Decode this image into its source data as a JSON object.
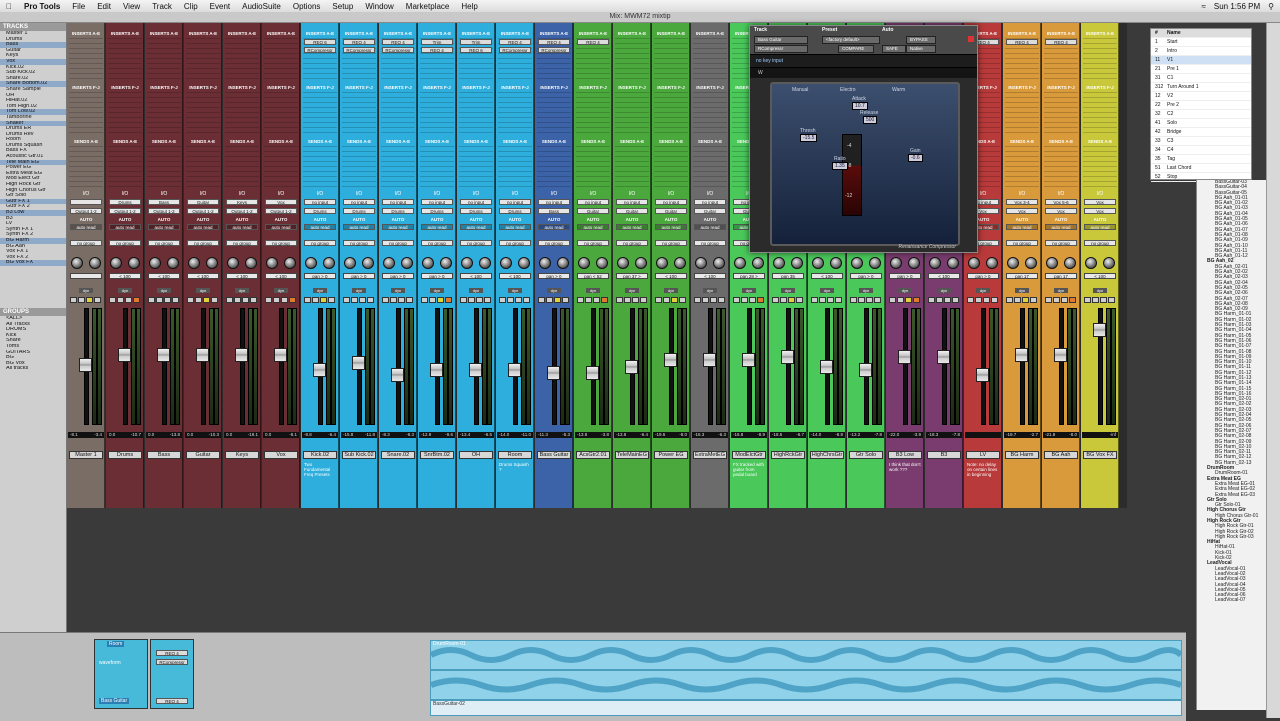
{
  "menubar": {
    "app": "Pro Tools",
    "items": [
      "File",
      "Edit",
      "View",
      "Track",
      "Clip",
      "Event",
      "AudioSuite",
      "Options",
      "Setup",
      "Window",
      "Marketplace",
      "Help"
    ],
    "clock": "Sun 1:56 PM"
  },
  "window_title": "Mix: MWM72 mixtip",
  "tracks_panel": {
    "title": "TRACKS",
    "items": [
      "Master 1",
      "Drums",
      "Bass",
      "Guitar",
      "Keys",
      "Vox",
      "Kick.02",
      "Sub Kick.02",
      "Snare.02",
      "Snare Bottom.02",
      "Snare Sample",
      "OH",
      "HiHat.02",
      "Tom High.02",
      "Tom Low.02",
      "Tamborine",
      "Shaker",
      "Drums ER",
      "Drums Rev",
      "Room",
      "Drums Squash",
      "Bass FX",
      "Acoustic Gtr.01",
      "Tele Main EG",
      "Power EG",
      "Extra Meat EG",
      "Mod Elect Gtr",
      "High Rock Gtr",
      "High Chorus Gtr",
      "Gtr Solo",
      "Gutr FX 1",
      "Gutr FX 2",
      "B3 Low",
      "B3",
      "LV",
      "Synth FX 1",
      "Synth FX 2",
      "BG Harm",
      "BG Aah",
      "Vox FX 1",
      "Vox FX 2",
      "BG Vox FX"
    ]
  },
  "groups_panel": {
    "title": "GROUPS",
    "items": [
      "<ALL>",
      "All Tracks",
      "DRUMS",
      "Kick",
      "Snare",
      "Toms",
      "GUITARS",
      "BG",
      "BG Vox",
      "All tracks"
    ]
  },
  "strip_headers": {
    "inserts_ae": "INSERTS A-E",
    "inserts_fj": "INSERTS F-J",
    "sends": "SENDS A-E",
    "io": "I/O",
    "auto": "AUTO",
    "group": "no group",
    "dyn": "dyn"
  },
  "strips": [
    {
      "name": "Master 1",
      "color": "#7a6d66",
      "input": "",
      "output": "Output 1-2",
      "auto": "auto read",
      "pan": "",
      "ins1": "",
      "ins2": "",
      "volL": "-8.1",
      "volR": "-3.4",
      "comment": ""
    },
    {
      "name": "Drums",
      "color": "#6b2e34",
      "input": "Drums",
      "output": "Output 1-2",
      "auto": "auto read",
      "pan": "< 100",
      "ins1": "",
      "ins2": "",
      "volL": "0.0",
      "volR": "-10.7",
      "comment": ""
    },
    {
      "name": "Bass",
      "color": "#6b2e34",
      "input": "Bass",
      "output": "Output 1-2",
      "auto": "auto read",
      "pan": "< 100",
      "ins1": "",
      "ins2": "",
      "volL": "0.0",
      "volR": "-13.8",
      "comment": ""
    },
    {
      "name": "Guitar",
      "color": "#6b2e34",
      "input": "Guitar",
      "output": "Output 1-2",
      "auto": "auto read",
      "pan": "< 100",
      "ins1": "",
      "ins2": "",
      "volL": "0.0",
      "volR": "-10.3",
      "comment": ""
    },
    {
      "name": "Keys",
      "color": "#6b2e34",
      "input": "Keys",
      "output": "Output 1-2",
      "auto": "auto read",
      "pan": "< 100",
      "ins1": "",
      "ins2": "",
      "volL": "0.0",
      "volR": "-19.1",
      "comment": ""
    },
    {
      "name": "Vox",
      "color": "#6b2e34",
      "input": "Vox",
      "output": "Output 1-2",
      "auto": "auto read",
      "pan": "< 100",
      "ins1": "",
      "ins2": "",
      "volL": "0.0",
      "volR": "-8.1",
      "comment": ""
    },
    {
      "name": "Kick.02",
      "color": "#2eaedc",
      "input": "no input",
      "output": "Drums",
      "auto": "auto read",
      "pan": "pan > 0",
      "ins1": "REQ 6",
      "ins2": "RCompressr",
      "volL": "-8.8",
      "volR": "-6.4",
      "comment": "Two Fundamental Freq Presets"
    },
    {
      "name": "Sub Kick.02",
      "color": "#2eaedc",
      "input": "no input",
      "output": "Drums",
      "auto": "auto read",
      "pan": "pan > 0",
      "ins1": "REQ 4",
      "ins2": "RCompressr",
      "volL": "-15.8",
      "volR": "-11.8",
      "comment": ""
    },
    {
      "name": "Snare.02",
      "color": "#2eaedc",
      "input": "no input",
      "output": "Drums",
      "auto": "auto read",
      "pan": "pan > 0",
      "ins1": "REQ 4",
      "ins2": "RCompressr",
      "volL": "-8.3",
      "volR": "-8.3",
      "comment": ""
    },
    {
      "name": "SnrBtm.02",
      "color": "#2eaedc",
      "input": "no input",
      "output": "Drums",
      "auto": "auto read",
      "pan": "pan > 0",
      "ins1": "Trim",
      "ins2": "REQ 4",
      "volL": "-12.9",
      "volR": "-9.6",
      "comment": ""
    },
    {
      "name": "OH",
      "color": "#2eaedc",
      "input": "no input",
      "output": "Drums",
      "auto": "auto read",
      "pan": "< 100",
      "ins1": "Trim",
      "ins2": "REQ 6",
      "volL": "-13.4",
      "volR": "-6.5",
      "comment": ""
    },
    {
      "name": "Room",
      "color": "#2eaedc",
      "input": "no input",
      "output": "Drums",
      "auto": "auto read",
      "pan": "< 100",
      "ins1": "REQ 4",
      "ins2": "RCompressr",
      "volL": "-14.0",
      "volR": "-11.0",
      "comment": "Drums Squash ?"
    },
    {
      "name": "Bass Guitar",
      "color": "#3c63a8",
      "input": "no input",
      "output": "Bass",
      "auto": "auto read",
      "pan": "pan > 0",
      "ins1": "REQ 4",
      "ins2": "RCompressr",
      "volL": "-11.3",
      "volR": "-5.3",
      "comment": ""
    },
    {
      "name": "AcsGtr2.01",
      "color": "#4aa83c",
      "input": "no input",
      "output": "Guitar",
      "auto": "auto read",
      "pan": "pan < 52",
      "ins1": "REQ 4",
      "ins2": "",
      "volL": "-13.8",
      "volR": "-3.8",
      "comment": ""
    },
    {
      "name": "TeleMainEG",
      "color": "#4aa83c",
      "input": "no input",
      "output": "Guitar",
      "auto": "auto read",
      "pan": "pan 37 >",
      "ins1": "",
      "ins2": "",
      "volL": "-13.8",
      "volR": "-6.4",
      "comment": ""
    },
    {
      "name": "Power EG",
      "color": "#4aa83c",
      "input": "no input",
      "output": "Guitar",
      "auto": "auto read",
      "pan": "< 100",
      "ins1": "",
      "ins2": "",
      "volL": "-19.6",
      "volR": "-8.0",
      "comment": ""
    },
    {
      "name": "ExtraMetEG",
      "color": "#6b6b6b",
      "input": "no input",
      "output": "Guitar",
      "auto": "auto read",
      "pan": "< 100",
      "ins1": "",
      "ins2": "",
      "volL": "-16.3",
      "volR": "-6.3",
      "comment": ""
    },
    {
      "name": "ModElctGtr",
      "color": "#4ac85a",
      "input": "no input",
      "output": "Guitar",
      "auto": "auto read",
      "pan": "pan 28 >",
      "ins1": "",
      "ins2": "",
      "volL": "-16.8",
      "volR": "-8.9",
      "comment": "FX tracked with guitar from pedal board"
    },
    {
      "name": "HighRckGtr",
      "color": "#4ac85a",
      "input": "no input",
      "output": "Guitar",
      "auto": "auto read",
      "pan": "pan 35",
      "ins1": "",
      "ins2": "",
      "volL": "-18.5",
      "volR": "-6.7",
      "comment": ""
    },
    {
      "name": "HighChrsGtr",
      "color": "#4ac85a",
      "input": "no input",
      "output": "Guitar",
      "auto": "auto read",
      "pan": "< 100",
      "ins1": "",
      "ins2": "",
      "volL": "-14.0",
      "volR": "-8.8",
      "comment": ""
    },
    {
      "name": "Gtr Solo",
      "color": "#4ac85a",
      "input": "no input",
      "output": "Guitar",
      "auto": "auto read",
      "pan": "pan > 0",
      "ins1": "",
      "ins2": "",
      "volL": "-13.2",
      "volR": "-7.8",
      "comment": ""
    },
    {
      "name": "B3 Low",
      "color": "#7a3c6e",
      "input": "no input",
      "output": "Keys",
      "auto": "auto read",
      "pan": "pan > 0",
      "ins1": "",
      "ins2": "",
      "volL": "-22.0",
      "volR": "-3.9",
      "comment": "I think that don't work ???"
    },
    {
      "name": "B3",
      "color": "#7a3c6e",
      "input": "no input",
      "output": "Keys",
      "auto": "auto read",
      "pan": "< 100",
      "ins1": "",
      "ins2": "",
      "volL": "-18.3",
      "volR": "-7.8",
      "comment": ""
    },
    {
      "name": "LV",
      "color": "#b83a3a",
      "input": "no input",
      "output": "Vox",
      "auto": "auto read",
      "pan": "pan > 0",
      "ins1": "REQ 4",
      "ins2": "",
      "volL": "",
      "volR": "",
      "comment": "Note: no delay on certain lines in beginning"
    },
    {
      "name": "BG Harm",
      "color": "#d89a3a",
      "input": "Vox 3-4",
      "output": "Vox",
      "auto": "auto read",
      "pan": "pan 17",
      "ins1": "REQ 4",
      "ins2": "",
      "volL": "-19.7",
      "volR": "-2.7",
      "comment": ""
    },
    {
      "name": "BG Aah",
      "color": "#d89a3a",
      "input": "Vox 5-6",
      "output": "Vox",
      "auto": "auto read",
      "pan": "pan 17",
      "ins1": "REQ 4",
      "ins2": "",
      "volL": "-21.8",
      "volR": "-8.0",
      "comment": ""
    },
    {
      "name": "BG Vox FX",
      "color": "#c8c83a",
      "input": "Vox",
      "output": "Vox",
      "auto": "auto read",
      "pan": "< 100",
      "ins1": "",
      "ins2": "",
      "volL": "",
      "volR": "-inf",
      "comment": ""
    }
  ],
  "fader_levels": [
    0.5,
    0.6,
    0.6,
    0.6,
    0.6,
    0.6,
    0.45,
    0.52,
    0.4,
    0.45,
    0.45,
    0.45,
    0.42,
    0.42,
    0.48,
    0.55,
    0.55,
    0.55,
    0.58,
    0.48,
    0.45,
    0.58,
    0.58,
    0.4,
    0.6,
    0.6,
    0.85
  ],
  "plugin": {
    "track_label": "Track",
    "preset_label": "Preset",
    "auto_label": "Auto",
    "track": "Bass Guitar",
    "insert": "RCompressr",
    "preset": "<factory default>",
    "compare": "COMPARE",
    "safe": "SAFE",
    "bypass": "BYPASS",
    "native": "Native",
    "key": "no key input",
    "waves": "W",
    "title": "Renaissance Compressor",
    "thresh_label": "Thresh",
    "thresh": "-15.5",
    "attack_label": "Attack",
    "attack": "10.7",
    "release_label": "Release",
    "release": "500",
    "ratio_label": "Ratio",
    "ratio": "1.35",
    "gain_label": "Gain",
    "gain": "-0.6",
    "manual": "Manual",
    "electro": "Electro",
    "warm": "Warm",
    "gr_scale": [
      "-4",
      "-8",
      "-12"
    ]
  },
  "markers": {
    "headers": [
      "#",
      "Name"
    ],
    "rows": [
      [
        "1",
        "Start"
      ],
      [
        "2",
        "Intro"
      ],
      [
        "11",
        "V1"
      ],
      [
        "21",
        "Pre 1"
      ],
      [
        "31",
        "C1"
      ],
      [
        "312",
        "Turn Around 1"
      ],
      [
        "12",
        "V2"
      ],
      [
        "22",
        "Pre 2"
      ],
      [
        "32",
        "C2"
      ],
      [
        "41",
        "Solo"
      ],
      [
        "42",
        "Bridge"
      ],
      [
        "33",
        "C3"
      ],
      [
        "34",
        "C4"
      ],
      [
        "35",
        "Tag"
      ],
      [
        "51",
        "Last Chord"
      ],
      [
        "52",
        "Stop"
      ]
    ]
  },
  "clip_list": [
    "BassGuitar-03",
    "BassGuitar-04",
    "BassGuitar-05",
    "BG Aah_01-01",
    "BG Aah_01-02",
    "BG Aah_01-03",
    "BG Aah_01-04",
    "BG Aah_01-05",
    "BG Aah_01-06",
    "BG Aah_01-07",
    "BG Aah_01-08",
    "BG Aah_01-09",
    "BG Aah_01-10",
    "BG Aah_01-11",
    "BG Aah_01-12",
    "BG Aah_02",
    "BG Aah_02-01",
    "BG Aah_02-02",
    "BG Aah_02-03",
    "BG Aah_02-04",
    "BG Aah_02-05",
    "BG Aah_02-06",
    "BG Aah_02-07",
    "BG Aah_02-08",
    "BG Aah_02-09",
    "BG Harm_01-01",
    "BG Harm_01-02",
    "BG Harm_01-03",
    "BG Harm_01-04",
    "BG Harm_01-05",
    "BG Harm_01-06",
    "BG Harm_01-07",
    "BG Harm_01-08",
    "BG Harm_01-09",
    "BG Harm_01-10",
    "BG Harm_01-11",
    "BG Harm_01-12",
    "BG Harm_01-13",
    "BG Harm_01-14",
    "BG Harm_01-15",
    "BG Harm_01-16",
    "BG Harm_02-01",
    "BG Harm_02-02",
    "BG Harm_02-03",
    "BG Harm_02-04",
    "BG Harm_02-05",
    "BG Harm_02-06",
    "BG Harm_02-07",
    "BG Harm_02-08",
    "BG Harm_02-09",
    "BG Harm_02-10",
    "BG Harm_02-11",
    "BG Harm_02-12",
    "BG Harm_02-13",
    "DrumRoom",
    "DrumRoom-01",
    "Extra Meat EG",
    "Extra Meat EG-01",
    "Extra Meat EG-02",
    "Extra Meat EG-03",
    "Gtr Solo",
    "Gtr Solo-01",
    "High Chorus Gtr",
    "High Chorus Gtr-01",
    "High Rock Gtr",
    "High Rock Gtr-01",
    "High Rock Gtr-02",
    "High Rock Gtr-03",
    "HiHat",
    "HiHat-01",
    "Kick-01",
    "Kick-02",
    "LeadVocal",
    "LeadVocal-01",
    "LeadVocal-02",
    "LeadVocal-03",
    "LeadVocal-04",
    "LeadVocal-05",
    "LeadVocal-06",
    "LeadVocal-07"
  ],
  "edit": {
    "track1": "Room",
    "track1_mode": "waveform",
    "track2": "Bass Guitar",
    "ins1": "REQ 4",
    "ins2": "RCompressr",
    "ins3": "REQ 4",
    "clip1": "DrumRoom-01",
    "clip2": "BassGuitar-02"
  }
}
